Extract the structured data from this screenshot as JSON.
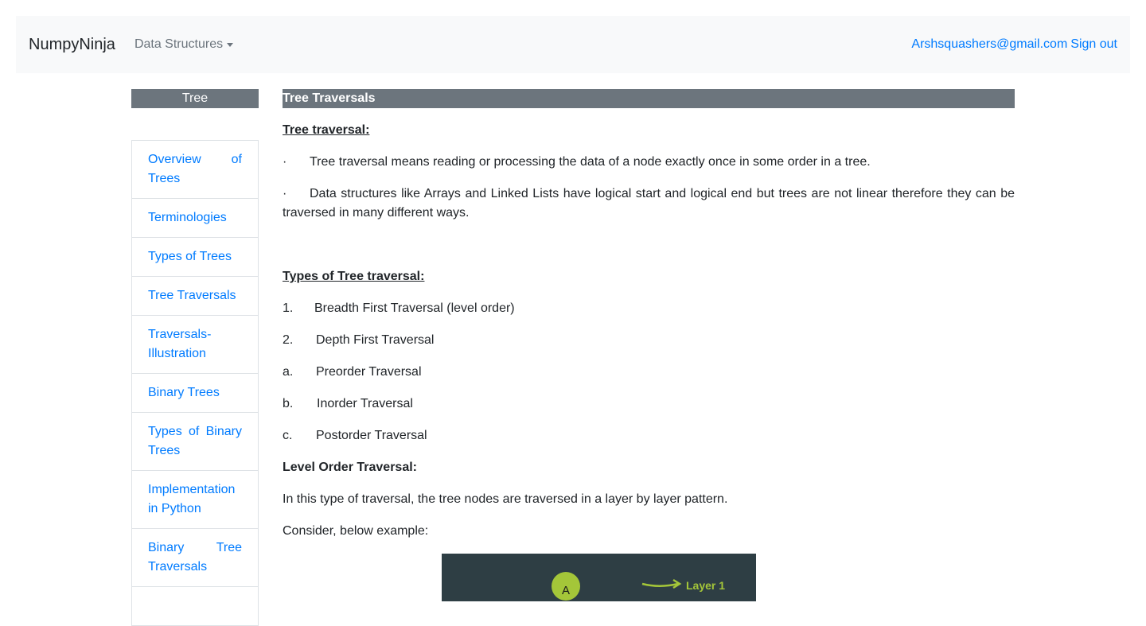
{
  "navbar": {
    "brand": "NumpyNinja",
    "dropdown_label": "Data Structures",
    "user_email": "Arshsquashers@gmail.com",
    "signout_label": "Sign out"
  },
  "sidebar": {
    "header": "Tree",
    "items": [
      {
        "line1": "Overview of",
        "line2": "Trees"
      },
      {
        "line1": "Terminologies",
        "line2": ""
      },
      {
        "line1": "Types of Trees",
        "line2": ""
      },
      {
        "line1": "Tree Traversals",
        "line2": ""
      },
      {
        "line1": "Traversals-",
        "line2": "Illustration"
      },
      {
        "line1": "Binary Trees",
        "line2": ""
      },
      {
        "line1": "Types of Binary",
        "line2": "Trees"
      },
      {
        "line1": "Implementation",
        "line2": "in Python"
      },
      {
        "line1": "Binary Tree",
        "line2": "Traversals"
      }
    ]
  },
  "content": {
    "header": "Tree Traversals",
    "section1_title": "Tree traversal:",
    "bullet_char": "·",
    "bullet1": "Tree traversal means reading or processing the data of a node exactly once in some order in a tree.",
    "bullet2": "Data structures like Arrays and Linked Lists have logical start and logical end but trees are not linear therefore they can be traversed in many different ways.",
    "section2_title": "Types of Tree traversal:",
    "list": [
      {
        "marker": "1.",
        "text": "Breadth First Traversal (level order)"
      },
      {
        "marker": "2.",
        "text": "Depth First Traversal"
      },
      {
        "marker": "a.",
        "text": "Preorder Traversal"
      },
      {
        "marker": "b.",
        "text": "Inorder Traversal"
      },
      {
        "marker": "c.",
        "text": "Postorder Traversal"
      }
    ],
    "section3_title": "Level Order Traversal:",
    "para1": "In this type of traversal, the tree nodes are traversed in a layer by layer pattern.",
    "para2": "Consider, below example:",
    "figure": {
      "node_label": "A",
      "layer_label": "Layer 1",
      "background": "#2e3e44",
      "node_color": "#a4c639",
      "arrow_color": "#a4c639"
    }
  }
}
